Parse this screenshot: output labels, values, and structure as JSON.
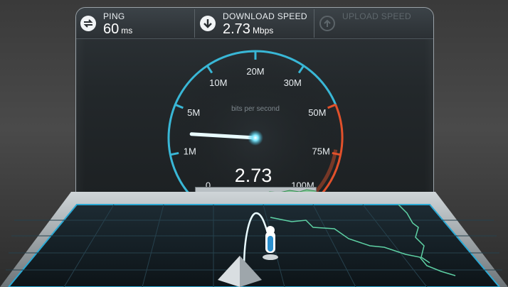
{
  "stats": {
    "ping": {
      "label": "PING",
      "value": "60",
      "unit": "ms",
      "icon": "ping-icon"
    },
    "download": {
      "label": "DOWNLOAD SPEED",
      "value": "2.73",
      "unit": "Mbps",
      "icon": "download-arrow-icon"
    },
    "upload": {
      "label": "UPLOAD SPEED",
      "icon": "upload-arrow-icon",
      "enabled": false
    }
  },
  "gauge": {
    "caption": "bits per second",
    "reading": "2.73",
    "needle_value_mbps": 2.73,
    "ticks": [
      {
        "label": "0"
      },
      {
        "label": "1M"
      },
      {
        "label": "5M"
      },
      {
        "label": "10M"
      },
      {
        "label": "20M"
      },
      {
        "label": "30M"
      },
      {
        "label": "50M"
      },
      {
        "label": "75M"
      },
      {
        "label": "100M"
      }
    ],
    "colors": {
      "normal": "#39b7d6",
      "high": "#e2512b",
      "needle": "#e9fbff",
      "graph_line": "#4bb86a"
    }
  }
}
